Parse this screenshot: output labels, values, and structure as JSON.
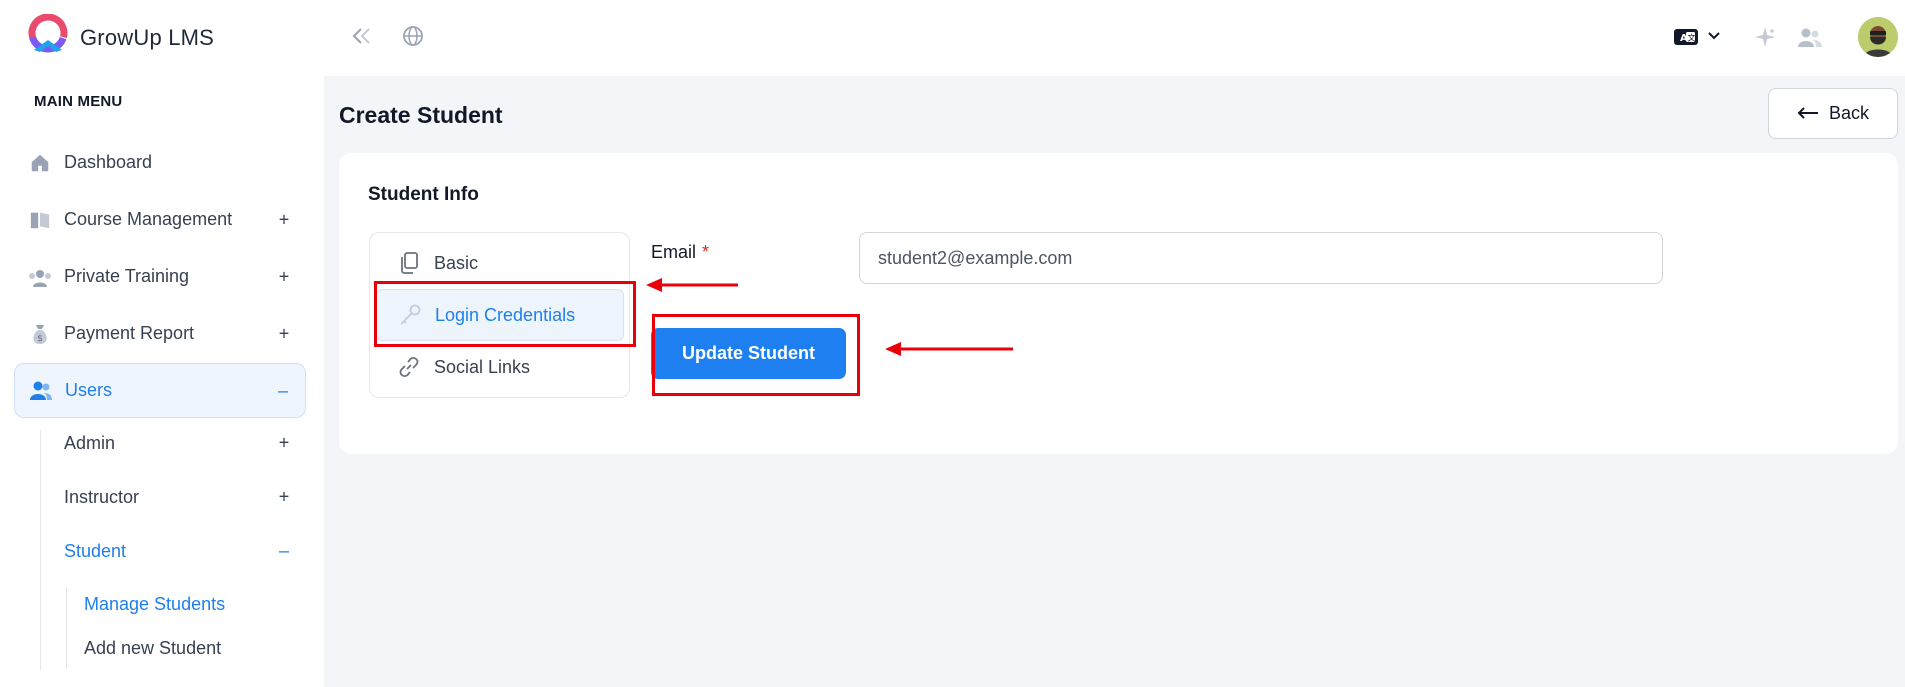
{
  "brand": {
    "name": "GrowUp LMS"
  },
  "sidebar": {
    "menu_title": "MAIN MENU",
    "items": [
      {
        "label": "Dashboard",
        "icon": "home-icon",
        "sign": ""
      },
      {
        "label": "Course Management",
        "icon": "book-icon",
        "sign": "+"
      },
      {
        "label": "Private Training",
        "icon": "training-icon",
        "sign": "+"
      },
      {
        "label": "Payment Report",
        "icon": "money-bag-icon",
        "sign": "+"
      },
      {
        "label": "Users",
        "icon": "users-icon",
        "sign": "–"
      }
    ],
    "users_sub": [
      {
        "label": "Admin",
        "sign": "+"
      },
      {
        "label": "Instructor",
        "sign": "+"
      },
      {
        "label": "Student",
        "sign": "–"
      }
    ],
    "student_sub": [
      {
        "label": "Manage Students"
      },
      {
        "label": "Add new Student"
      }
    ]
  },
  "topbar": {
    "icons": [
      "collapse-icon",
      "globe-icon",
      "language-icon",
      "chevron-down-icon",
      "sparkle-icon",
      "users-switch-icon",
      "avatar"
    ]
  },
  "page": {
    "title": "Create Student",
    "back_label": "Back"
  },
  "card": {
    "title": "Student Info",
    "tabs": [
      {
        "label": "Basic",
        "icon": "copy-icon"
      },
      {
        "label": "Login Credentials",
        "icon": "key-icon"
      },
      {
        "label": "Social Links",
        "icon": "link-icon"
      }
    ],
    "email_label": "Email",
    "required_mark": "*",
    "email_value": "student2@example.com",
    "submit_label": "Update Student"
  },
  "colors": {
    "accent": "#1e80f0",
    "annotation": "#e8000b"
  }
}
